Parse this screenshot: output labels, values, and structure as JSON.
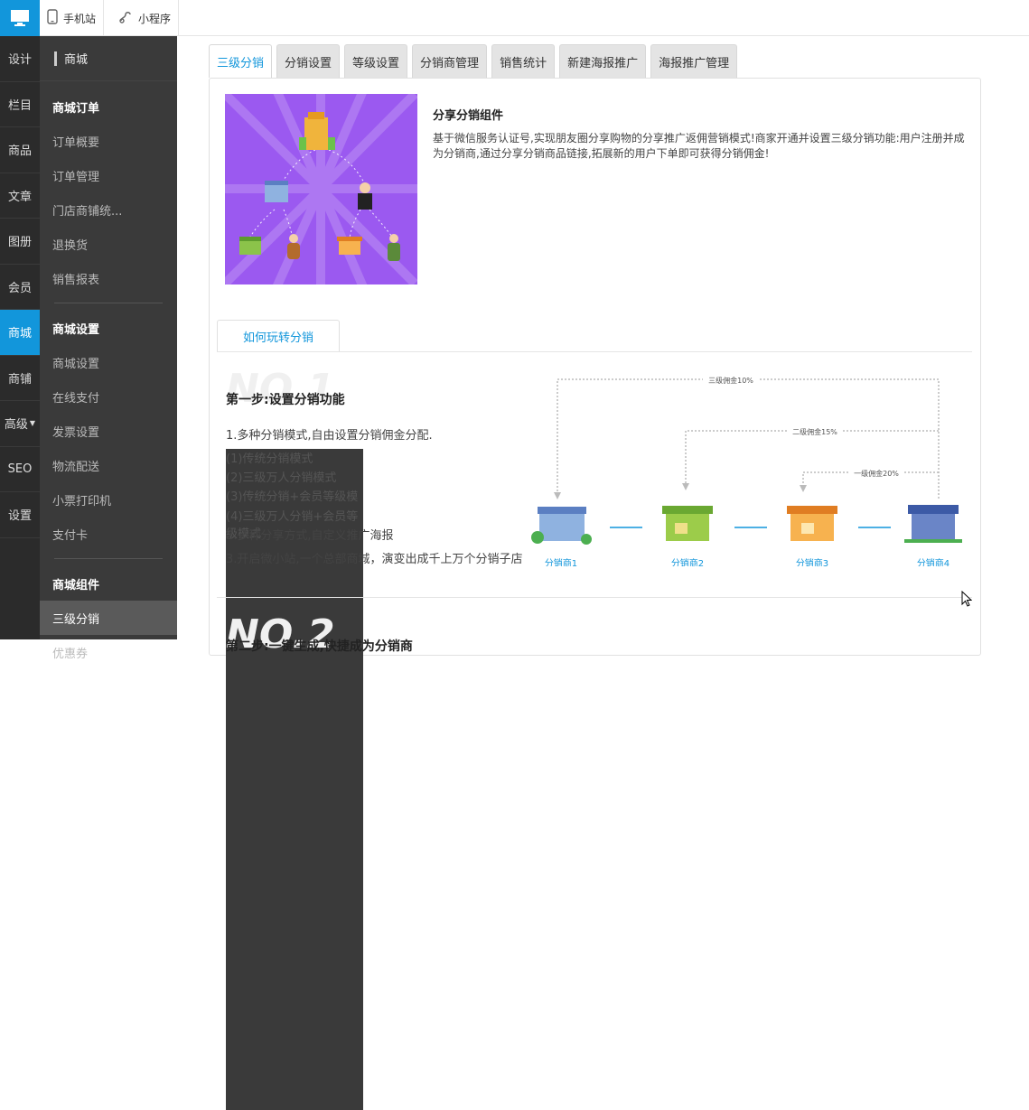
{
  "top": {
    "tabs": [
      {
        "label": "手机站",
        "icon": "phone-icon"
      },
      {
        "label": "小程序",
        "icon": "miniprogram-icon"
      }
    ]
  },
  "rail": {
    "items": [
      "设计",
      "栏目",
      "商品",
      "文章",
      "图册",
      "会员",
      "商城",
      "商铺",
      "高级",
      "SEO",
      "设置"
    ],
    "active": "商城"
  },
  "sidebar": {
    "title": "商城",
    "groups": [
      {
        "label": "商城订单",
        "items": [
          "订单概要",
          "订单管理",
          "门店商铺统...",
          "退换货",
          "销售报表"
        ]
      },
      {
        "label": "商城设置",
        "items": [
          "商城设置",
          "在线支付",
          "发票设置",
          "物流配送",
          "小票打印机",
          "支付卡"
        ]
      },
      {
        "label": "商城组件",
        "items": [
          "三级分销",
          "优惠券"
        ]
      }
    ],
    "active_item": "三级分销"
  },
  "tabs": [
    "三级分销",
    "分销设置",
    "等级设置",
    "分销商管理",
    "销售统计",
    "新建海报推广",
    "海报推广管理"
  ],
  "active_tab": "三级分销",
  "intro": {
    "title": "分享分销组件",
    "text": "基于微信服务认证号,实现朋友圈分享购物的分享推广返佣营销模式!商家开通并设置三级分销功能:用户注册并成为分销商,通过分享分销商品链接,拓展新的用户下单即可获得分销佣金!"
  },
  "inner_tab": "如何玩转分销",
  "step1": {
    "watermark": "NO.1",
    "title": "第一步:设置分销功能",
    "lines": [
      "1.多种分销模式,自由设置分销佣金分配.",
      "(1)传统分销模式",
      "(2)三级万人分销模式",
      "(3)传统分销+会员等级模式",
      "(4)三级万人分销+会员等级模式",
      "2.多种分享方式,自定义推广海报",
      "3.开启微小站,一个总部商城，演变出成千上万个分销子店"
    ]
  },
  "diagram": {
    "commissions": [
      "三级佣金10%",
      "二级佣金15%",
      "一级佣金20%"
    ],
    "nodes": [
      "分销商1",
      "分销商2",
      "分销商3",
      "分销商4"
    ],
    "accent": "#1296db"
  },
  "step2": {
    "watermark": "NO.2",
    "title": "第二步:一键生成,快捷成为分销商"
  }
}
